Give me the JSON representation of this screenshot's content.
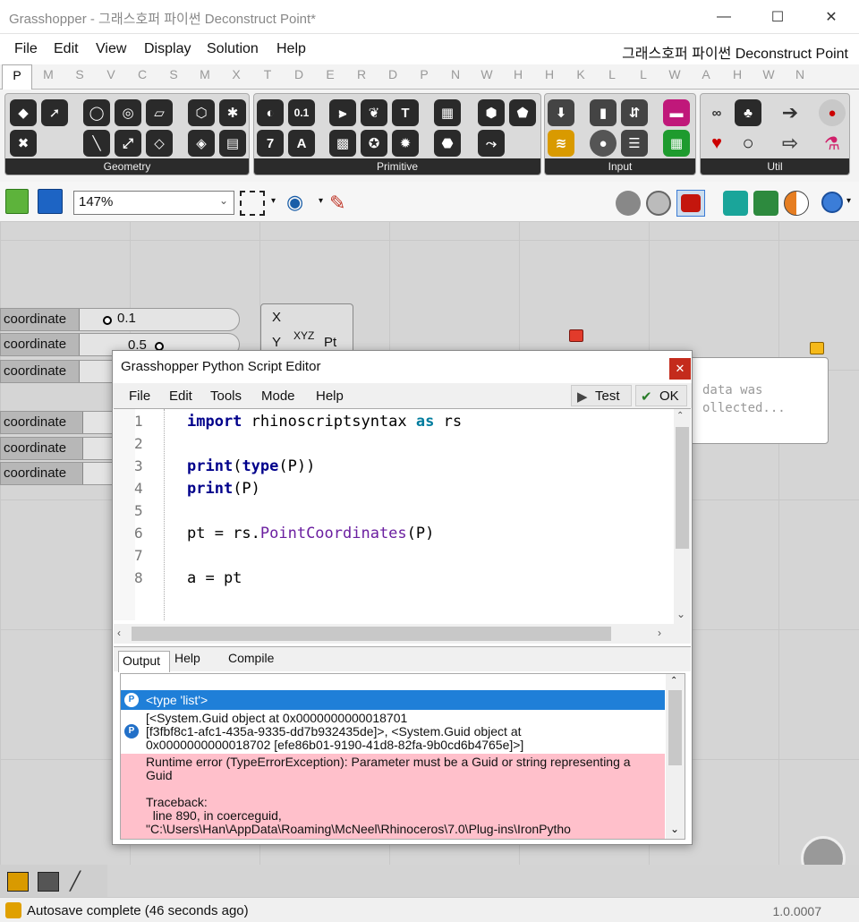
{
  "window": {
    "title": "Grasshopper - 그래스호퍼 파이썬 Deconstruct Point*",
    "doc_title": "그래스호퍼 파이썬 Deconstruct Point",
    "min": "—",
    "max": "☐",
    "close": "✕"
  },
  "menu": [
    "File",
    "Edit",
    "View",
    "Display",
    "Solution",
    "Help"
  ],
  "tabs": [
    "P",
    "M",
    "S",
    "V",
    "C",
    "S",
    "M",
    "X",
    "T",
    "D",
    "E",
    "R",
    "D",
    "P",
    "N",
    "W",
    "H",
    "H",
    "K",
    "L",
    "L",
    "W",
    "A",
    "H",
    "W",
    "N"
  ],
  "ribbon": {
    "panels": [
      "Geometry",
      "Primitive",
      "Input",
      "Util"
    ],
    "primitive_labels": {
      "num": "0.1",
      "seven": "7",
      "a": "A",
      "t": "T"
    }
  },
  "toolbar": {
    "zoom": "147%"
  },
  "canvas": {
    "sliders": [
      {
        "label": "coordinate",
        "value": "0.1"
      },
      {
        "label": "coordinate",
        "value": "0.5"
      },
      {
        "label": "coordinate",
        "value": ""
      },
      {
        "label": "coordinate",
        "value": ""
      },
      {
        "label": "coordinate",
        "value": ""
      },
      {
        "label": "coordinate",
        "value": ""
      }
    ],
    "node": {
      "inputs": [
        "X",
        "Y"
      ],
      "icon": "XYZ",
      "output": "Pt"
    },
    "panel_text": [
      "data was",
      "ollected..."
    ]
  },
  "editor": {
    "title": "Grasshopper Python Script Editor",
    "close": "✕",
    "menu": [
      "File",
      "Edit",
      "Tools",
      "Mode",
      "Help"
    ],
    "test": "Test",
    "ok": "OK",
    "lines": [
      {
        "n": "1",
        "parts": [
          {
            "t": "import",
            "c": "kw"
          },
          {
            "t": " rhinoscriptsyntax ",
            "c": ""
          },
          {
            "t": "as",
            "c": "as"
          },
          {
            "t": " rs",
            "c": ""
          }
        ]
      },
      {
        "n": "2",
        "parts": []
      },
      {
        "n": "3",
        "parts": [
          {
            "t": "print",
            "c": "kw"
          },
          {
            "t": "(",
            "c": ""
          },
          {
            "t": "type",
            "c": "kw"
          },
          {
            "t": "(P))",
            "c": ""
          }
        ]
      },
      {
        "n": "4",
        "parts": [
          {
            "t": "print",
            "c": "kw"
          },
          {
            "t": "(P)",
            "c": ""
          }
        ]
      },
      {
        "n": "5",
        "parts": []
      },
      {
        "n": "6",
        "parts": [
          {
            "t": "pt = rs.",
            "c": ""
          },
          {
            "t": "PointCoordinates",
            "c": "fn"
          },
          {
            "t": "(P)",
            "c": ""
          }
        ]
      },
      {
        "n": "7",
        "parts": []
      },
      {
        "n": "8",
        "parts": [
          {
            "t": "a = pt",
            "c": ""
          }
        ]
      }
    ],
    "output_tabs": [
      "Output",
      "Help",
      "Compile"
    ],
    "output": {
      "type_line": "<type 'list'>",
      "guid_lines": [
        "[<System.Guid object at 0x0000000000018701",
        "[f3fbf8c1-afc1-435a-9335-dd7b932435de]>, <System.Guid object at",
        "0x0000000000018702 [efe86b01-9190-41d8-82fa-9b0cd6b4765e]>]"
      ],
      "error_lines": [
        "Runtime error (TypeErrorException): Parameter must be a Guid or string representing a",
        "Guid",
        "",
        "Traceback:",
        "  line 890, in coerceguid,",
        "\"C:\\Users\\Han\\AppData\\Roaming\\McNeel\\Rhinoceros\\7.0\\Plug-ins\\IronPytho"
      ]
    }
  },
  "status": {
    "text": "Autosave complete (46 seconds ago)",
    "version": "1.0.0007"
  },
  "colors": {
    "selection": "#1f7fd8",
    "error": "#ffc0cb",
    "close": "#c42b1c"
  }
}
